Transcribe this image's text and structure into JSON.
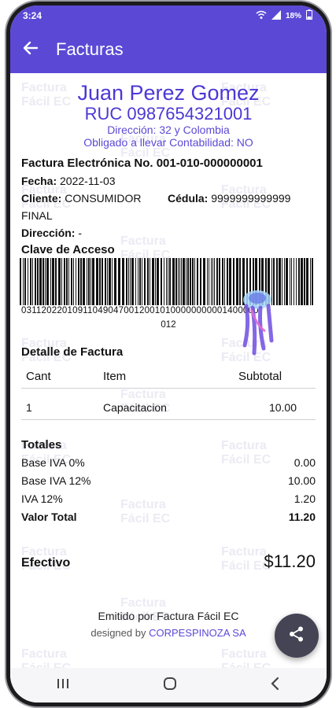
{
  "status_bar": {
    "time": "3:24",
    "battery": "18%"
  },
  "app_bar": {
    "title": "Facturas"
  },
  "watermark": {
    "line1": "Factura",
    "line2": "Fácil EC"
  },
  "issuer": {
    "name": "Juan Perez Gomez",
    "ruc": "RUC 0987654321001",
    "address": "Dirección: 32 y Colombia",
    "accounting": "Obligado a llevar Contabilidad: NO"
  },
  "invoice": {
    "number": "Factura Electrónica No. 001-010-000000001",
    "date_label": "Fecha:",
    "date_value": "2022-11-03",
    "client_label": "Cliente:",
    "client_value_1": "CONSUMIDOR",
    "client_value_2": "FINAL",
    "id_label": "Cédula:",
    "id_value": "9999999999999",
    "address_label": "Dirección:",
    "address_value": "-",
    "access_key_label": "Clave de Acceso",
    "access_key_1": "0311202201091104904700120010100000000001400000",
    "access_key_2": "012"
  },
  "detail": {
    "title": "Detalle de Factura",
    "headers": [
      "Cant",
      "Item",
      "Subtotal"
    ],
    "rows": [
      {
        "qty": "1",
        "item": "Capacitacion",
        "subtotal": "10.00"
      }
    ]
  },
  "totals": {
    "title": "Totales",
    "lines": [
      {
        "label": "Base IVA 0%",
        "value": "0.00"
      },
      {
        "label": "Base IVA 12%",
        "value": "10.00"
      },
      {
        "label": "IVA 12%",
        "value": "1.20"
      },
      {
        "label": "Valor Total",
        "value": "11.20"
      }
    ],
    "payment_label": "Efectivo",
    "payment_value": "$11.20"
  },
  "footer": {
    "emitted": "Emitido por Factura Fácil EC",
    "designed_prefix": "designed by",
    "designed_by": "CORPESPINOZA SA"
  },
  "colors": {
    "primary": "#5b49d6",
    "link": "#4b38d4",
    "fab": "#444455"
  },
  "icons": {
    "back": "arrow-left-icon",
    "share": "share-icon"
  }
}
